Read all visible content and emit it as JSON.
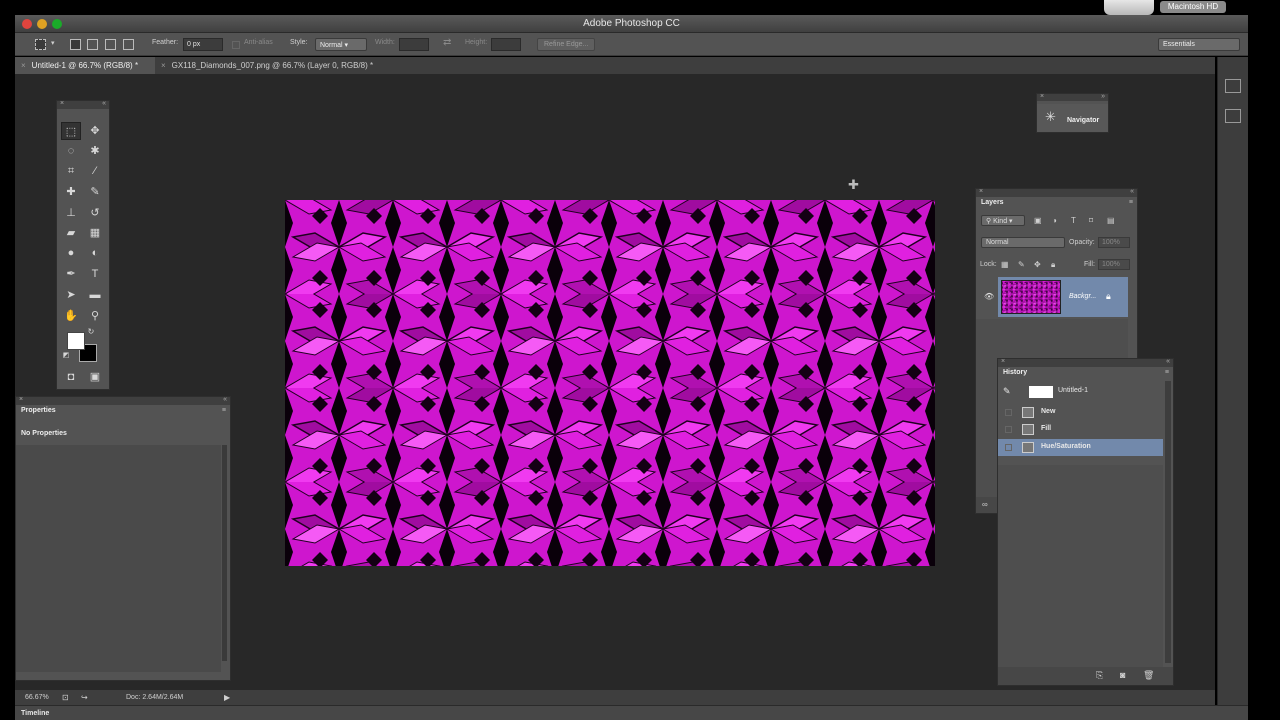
{
  "app": {
    "title": "Adobe Photoshop CC"
  },
  "desktop": {
    "drive_label": "Macintosh HD"
  },
  "options": {
    "feather_label": "Feather:",
    "feather_value": "0 px",
    "antialias_label": "Anti-alias",
    "style_label": "Style:",
    "style_value": "Normal",
    "width_label": "Width:",
    "height_label": "Height:",
    "refine_edge": "Refine Edge...",
    "workspace": "Essentials"
  },
  "tabs": [
    {
      "label": "Untitled-1 @ 66.7% (RGB/8) *",
      "active": true
    },
    {
      "label": "GX118_Diamonds_007.png @ 66.7% (Layer 0, RGB/8) *",
      "active": false
    }
  ],
  "properties": {
    "title": "Properties",
    "empty_text": "No Properties"
  },
  "navigator": {
    "title": "Navigator"
  },
  "layers": {
    "title": "Layers",
    "kind_filter": "Kind",
    "blend_mode": "Normal",
    "opacity_label": "Opacity:",
    "opacity_value": "100%",
    "lock_label": "Lock:",
    "fill_label": "Fill:",
    "fill_value": "100%",
    "items": [
      {
        "name": "Backgr...",
        "locked": true,
        "visible": true
      }
    ]
  },
  "history": {
    "title": "History",
    "snapshot": "Untitled-1",
    "items": [
      {
        "label": "New",
        "selected": false
      },
      {
        "label": "Fill",
        "selected": false
      },
      {
        "label": "Hue/Saturation",
        "selected": true
      }
    ]
  },
  "status": {
    "zoom": "66.67%",
    "doc": "Doc: 2.64M/2.64M"
  },
  "timeline": {
    "label": "Timeline"
  },
  "colors": {
    "canvas_magenta": "#e21de2",
    "selection_blue": "#7289ab",
    "foreground": "#ffffff",
    "background": "#000000"
  }
}
